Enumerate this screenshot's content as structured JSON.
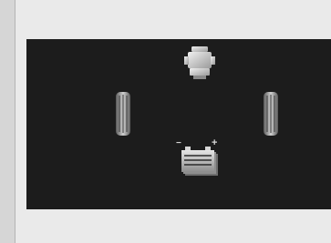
{
  "display": {
    "screen_bg": "#1c1c1c",
    "icon_color": "#c8c8c8"
  },
  "icons": {
    "engine": "engine-icon",
    "left_wheel": "wheel-icon",
    "right_wheel": "wheel-icon",
    "battery": "battery-icon"
  },
  "battery_terminals": {
    "negative": "−",
    "positive": "+"
  }
}
